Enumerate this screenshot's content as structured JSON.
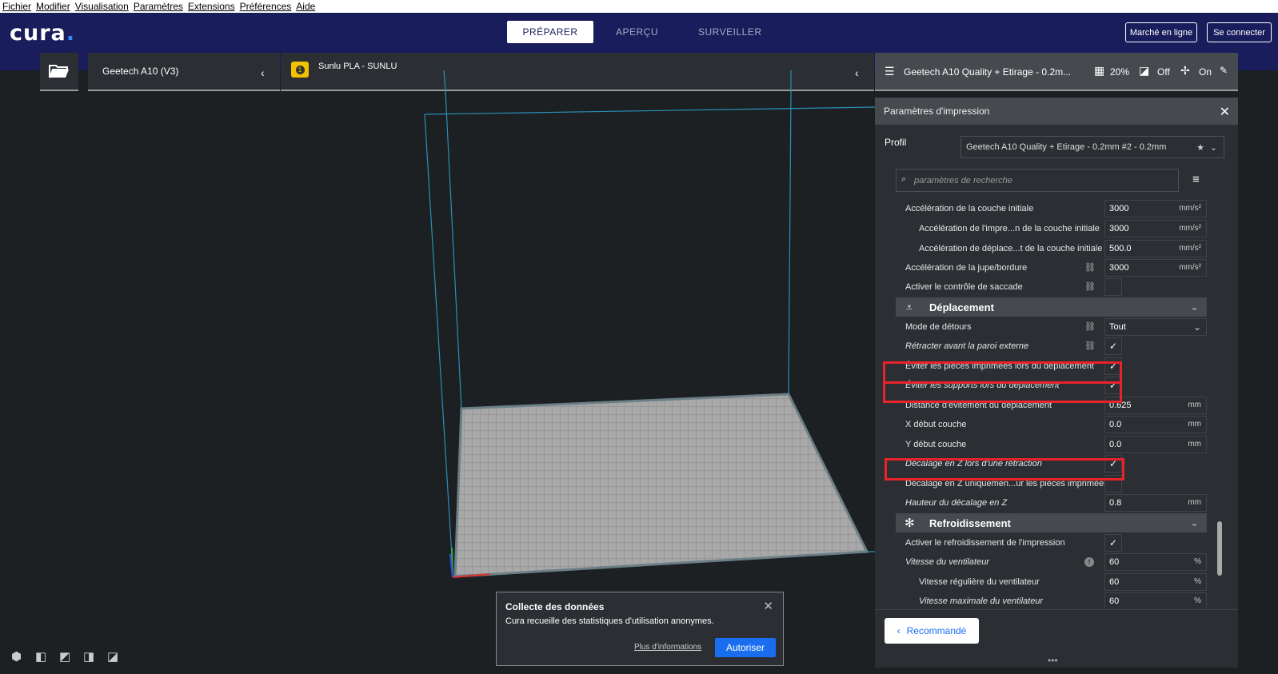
{
  "menu": [
    "Fichier",
    "Modifier",
    "Visualisation",
    "Paramètres",
    "Extensions",
    "Préférences",
    "Aide"
  ],
  "header": {
    "logo": "cura",
    "tabs": [
      "PRÉPARER",
      "APERÇU",
      "SURVEILLER"
    ],
    "marketplace": "Marché en ligne",
    "signin": "Se connecter"
  },
  "stage": {
    "printer": "Geetech A10 (V3)",
    "material_count": "1",
    "material": "Sunlu PLA - SUNLU",
    "profile_summary": "Geetech A10 Quality + Etirage - 0.2m...",
    "infill": "20%",
    "support": "Off",
    "adhesion": "On"
  },
  "panel": {
    "title": "Paramètres d'impression",
    "profile_label": "Profil",
    "profile_value": "Geetech A10 Quality + Etirage - 0.2mm #2 - 0.2mm",
    "search_placeholder": "paramètres de recherche",
    "recommended": "Recommandé"
  },
  "settings": {
    "r1": {
      "label": "Accélération de la couche initiale",
      "value": "3000",
      "unit": "mm/s²"
    },
    "r2": {
      "label": "Accélération de l'impre...n de la couche initiale",
      "value": "3000",
      "unit": "mm/s²"
    },
    "r3": {
      "label": "Accélération de déplace...t de la couche initiale",
      "value": "500.0",
      "unit": "mm/s²"
    },
    "r4": {
      "label": "Accélération de la jupe/bordure",
      "value": "3000",
      "unit": "mm/s²"
    },
    "r5": {
      "label": "Activer le contrôle de saccade"
    },
    "cat1": "Déplacement",
    "r6": {
      "label": "Mode de détours",
      "value": "Tout"
    },
    "r7": {
      "label": "Rétracter avant la paroi externe"
    },
    "r8": {
      "label": "Éviter les pièces imprimées lors du déplacement"
    },
    "r9": {
      "label": "Éviter les supports lors du déplacement"
    },
    "r10": {
      "label": "Distance d'évitement du déplacement",
      "value": "0.625",
      "unit": "mm"
    },
    "r11": {
      "label": "X début couche",
      "value": "0.0",
      "unit": "mm"
    },
    "r12": {
      "label": "Y début couche",
      "value": "0.0",
      "unit": "mm"
    },
    "r13": {
      "label": "Décalage en Z lors d'une rétraction"
    },
    "r14": {
      "label": "Décalage en Z uniquemen...ur les pièces imprimées"
    },
    "r15": {
      "label": "Hauteur du décalage en Z",
      "value": "0.8",
      "unit": "mm"
    },
    "cat2": "Refroidissement",
    "r16": {
      "label": "Activer le refroidissement de l'impression"
    },
    "r17": {
      "label": "Vitesse du ventilateur",
      "value": "60",
      "unit": "%"
    },
    "r18": {
      "label": "Vitesse régulière du ventilateur",
      "value": "60",
      "unit": "%"
    },
    "r19": {
      "label": "Vitesse maximale du ventilateur",
      "value": "60",
      "unit": "%"
    }
  },
  "dialog": {
    "title": "Collecte des données",
    "message": "Cura recueille des statistiques d'utilisation anonymes.",
    "more": "Plus d'informations",
    "allow": "Autoriser"
  }
}
